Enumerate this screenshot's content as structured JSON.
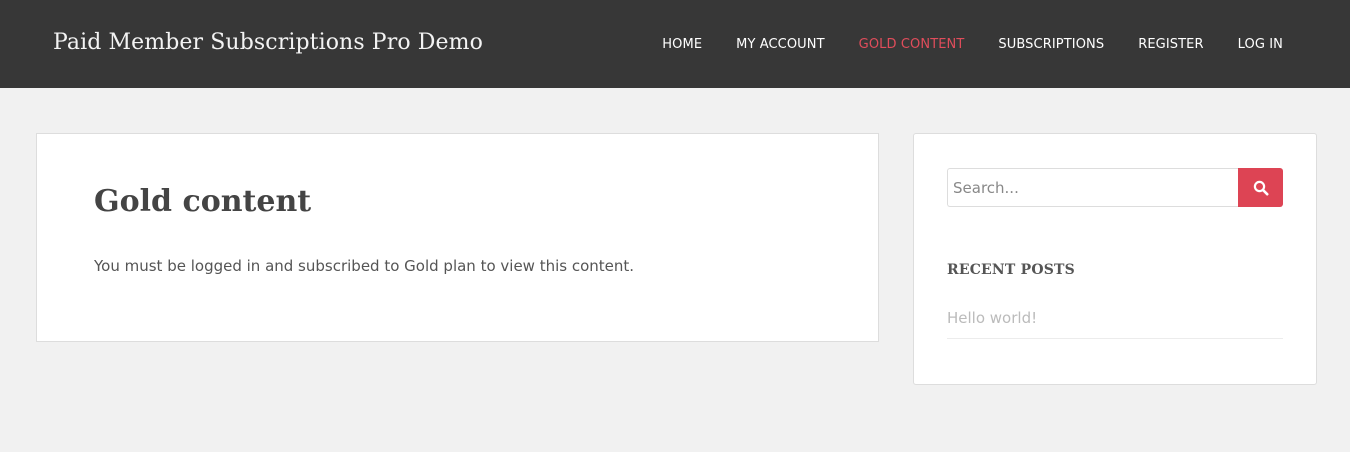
{
  "header": {
    "site_title": "Paid Member Subscriptions Pro Demo",
    "nav": [
      {
        "label": "HOME"
      },
      {
        "label": "MY ACCOUNT"
      },
      {
        "label": "GOLD CONTENT",
        "active": true
      },
      {
        "label": "SUBSCRIPTIONS"
      },
      {
        "label": "REGISTER"
      },
      {
        "label": "LOG IN"
      }
    ]
  },
  "main": {
    "title": "Gold content",
    "message": "You must be logged in and subscribed to Gold plan to view this content."
  },
  "sidebar": {
    "search": {
      "placeholder": "Search...",
      "value": "",
      "icon": "search-icon"
    },
    "recent_posts": {
      "title": "RECENT POSTS",
      "items": [
        {
          "label": "Hello world!"
        }
      ]
    }
  },
  "colors": {
    "header_bg": "#373737",
    "accent": "#dd4454",
    "page_bg": "#f1f1f1"
  }
}
